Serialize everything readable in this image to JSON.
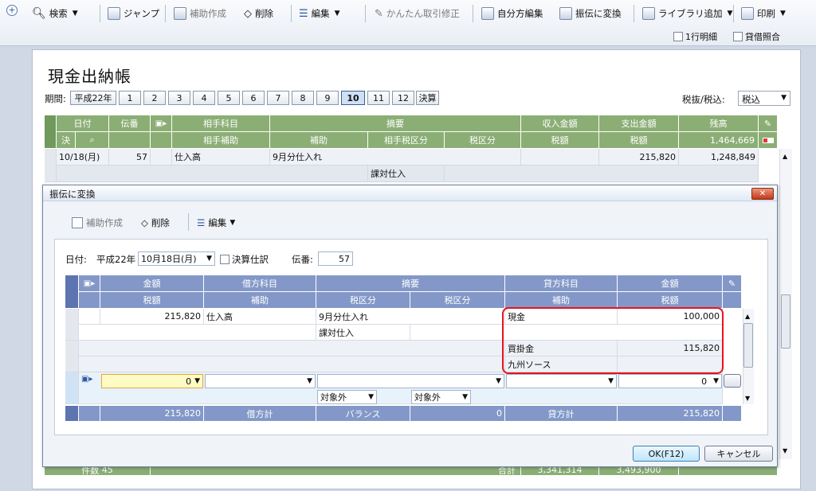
{
  "toolbar": {
    "search": "検索",
    "jump": "ジャンプ",
    "aux_create": "補助作成",
    "delete": "削除",
    "edit": "編集",
    "easy_fix": "かんたん取引修正",
    "self_edit": "自分方編集",
    "convert": "振伝に変換",
    "library_add": "ライブラリ追加",
    "print": "印刷",
    "one_line": "1行明細",
    "balance_check": "貸借照合"
  },
  "page": {
    "title": "現金出納帳",
    "period_label": "期間:",
    "era": "平成22年",
    "months": [
      "1",
      "2",
      "3",
      "4",
      "5",
      "6",
      "7",
      "8",
      "9",
      "10",
      "11",
      "12",
      "決算"
    ],
    "selected_month": "10",
    "tax_label": "税抜/税込:",
    "tax_value": "税込"
  },
  "grid": {
    "h1": [
      "日付",
      "伝番",
      "",
      "相手科目",
      "摘要",
      "収入金額",
      "支出金額",
      "残高"
    ],
    "h2": [
      "決",
      "",
      "",
      "相手補助",
      "補助",
      "相手税区分",
      "税区分",
      "税額",
      "税額",
      "1,464,669"
    ],
    "row1": {
      "date": "10/18(月)",
      "no": "57",
      "account": "仕入高",
      "memo": "9月分仕入れ",
      "expense": "215,820",
      "balance": "1,248,849"
    },
    "row2": {
      "tax": "課対仕入"
    },
    "footer": {
      "count": "件数",
      "count_val": "45",
      "total": "合計",
      "income_total": "3,341,314",
      "expense_total": "3,493,900"
    }
  },
  "dialog": {
    "title": "振伝に変換",
    "aux_create": "補助作成",
    "delete": "削除",
    "edit": "編集",
    "date_label": "日付:",
    "era": "平成22年",
    "date_value": "10月18日(月)",
    "closing_label": "決算仕訳",
    "slip_label": "伝番:",
    "slip_value": "57",
    "h1": [
      "金額",
      "借方科目",
      "摘要",
      "貸方科目",
      "金額"
    ],
    "h2": [
      "税額",
      "補助",
      "税区分",
      "税区分",
      "補助",
      "税額"
    ],
    "rows": {
      "debit_amount": "215,820",
      "debit_account": "仕入高",
      "memo": "9月分仕入れ",
      "tax_class": "課対仕入",
      "credit1_account": "現金",
      "credit1_amount": "100,000",
      "credit2_account": "買掛金",
      "credit2_amount": "115,820",
      "credit2_sub": "九州ソース"
    },
    "input": {
      "amount": "0",
      "tax1": "対象外",
      "tax2": "対象外",
      "credit_amount": "0"
    },
    "footer": {
      "debit_total": "215,820",
      "debit_label": "借方計",
      "balance_label": "バランス",
      "balance_val": "0",
      "credit_label": "貸方計",
      "credit_total": "215,820"
    },
    "ok": "OK(F12)",
    "cancel": "キャンセル"
  },
  "colors": {
    "grid_header": "#8bae75",
    "dialog_header": "#8398c8",
    "highlight": "#e8121d"
  }
}
